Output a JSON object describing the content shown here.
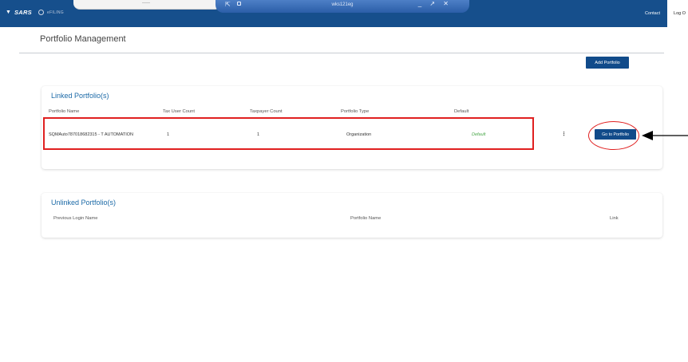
{
  "header": {
    "logo_text": "SARS",
    "efiling_text": "eFILING",
    "contact": "Contact",
    "logout": "Log O"
  },
  "rdp": {
    "title": "wks121eg",
    "controls": "_ ↗ ✕"
  },
  "page": {
    "title": "Portfolio Management",
    "add_button": "Add Portfolio"
  },
  "linked": {
    "title": "Linked Portfolio(s)",
    "columns": [
      "Portfolio Name",
      "Tax User Count",
      "Taxpayer Count",
      "Portfolio Type",
      "Default"
    ],
    "rows": [
      {
        "portfolio_name": "SQMAuto787018682315 - T AUTOMATION",
        "tax_user_count": "1",
        "taxpayer_count": "1",
        "portfolio_type": "Organization",
        "default": "Default",
        "action": "Go to Portfolio"
      }
    ]
  },
  "unlinked": {
    "title": "Unlinked Portfolio(s)",
    "columns": [
      "Previous Login Name",
      "Portfolio Name",
      "Link"
    ]
  },
  "colors": {
    "header_bg": "#164f8c",
    "button_bg": "#114b8a",
    "title_blue": "#1c6aa7",
    "default_green": "#4aa84a",
    "annotation_red": "#e02020"
  }
}
